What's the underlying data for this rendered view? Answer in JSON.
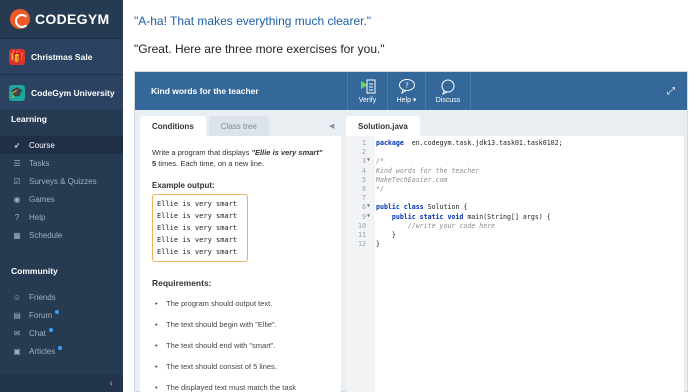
{
  "sidebar": {
    "logo": "CODEGYM",
    "promos": [
      {
        "label": "Christmas Sale",
        "icon": "gift-icon"
      },
      {
        "label": "CodeGym University",
        "icon": "graduation-cap-icon"
      }
    ],
    "learning_title": "Learning",
    "learning_items": [
      {
        "label": "Course",
        "icon": "rocket-icon",
        "active": true
      },
      {
        "label": "Tasks",
        "icon": "list-icon"
      },
      {
        "label": "Surveys & Quizzes",
        "icon": "checklist-icon"
      },
      {
        "label": "Games",
        "icon": "gamepad-icon"
      },
      {
        "label": "Help",
        "icon": "help-circle-icon"
      },
      {
        "label": "Schedule",
        "icon": "calendar-icon"
      }
    ],
    "community_title": "Community",
    "community_items": [
      {
        "label": "Friends",
        "icon": "users-icon"
      },
      {
        "label": "Forum",
        "icon": "forum-icon",
        "dot": true
      },
      {
        "label": "Chat",
        "icon": "chat-icon",
        "dot": true
      },
      {
        "label": "Articles",
        "icon": "articles-icon",
        "dot": true
      }
    ],
    "collapse_icon": "chevron-left-icon"
  },
  "dialog": {
    "line1": "\"A-ha! That makes everything much clearer.\"",
    "line2": "\"Great. Here are three more exercises for you.\""
  },
  "task": {
    "title": "Kind words for the teacher",
    "buttons": [
      {
        "label": "Verify",
        "icon": "verify-icon"
      },
      {
        "label": "Help",
        "icon": "help-bubble-icon"
      },
      {
        "label": "Discuss",
        "icon": "discuss-icon"
      }
    ],
    "tabs": [
      "Conditions",
      "Class tree"
    ],
    "file_tab": "Solution.java",
    "conditions": {
      "intro_before": "Write a program that displays ",
      "intro_highlight": "\"Ellie is very smart\"",
      "intro_count": "5",
      "intro_after": " times. Each time, on a new line.",
      "example_label": "Example output:",
      "example_lines": [
        "Ellie is very smart",
        "Ellie is very smart",
        "Ellie is very smart",
        "Ellie is very smart",
        "Ellie is very smart"
      ],
      "requirements_title": "Requirements:",
      "requirements": [
        "The program should output text.",
        "The text should begin with \"Ellie\".",
        "The text should end with \"smart\".",
        "The text should consist of 5 lines.",
        "The displayed text must match the task"
      ]
    },
    "code_lines": [
      {
        "n": "1",
        "parts": [
          [
            "kw",
            "package"
          ],
          [
            "",
            "  en.codegym.task.jdk13.task01.task0102;"
          ]
        ]
      },
      {
        "n": "2",
        "parts": []
      },
      {
        "n": "3",
        "fold": true,
        "parts": [
          [
            "cm",
            "/*"
          ]
        ]
      },
      {
        "n": "4",
        "parts": [
          [
            "cm",
            "Kind words for the teacher"
          ]
        ]
      },
      {
        "n": "5",
        "parts": [
          [
            "cm",
            "MakeTechEasier.com"
          ]
        ]
      },
      {
        "n": "6",
        "parts": [
          [
            "cm",
            "*/"
          ]
        ]
      },
      {
        "n": "7",
        "parts": []
      },
      {
        "n": "8",
        "fold": true,
        "parts": [
          [
            "kw",
            "public class"
          ],
          [
            "",
            " Solution {"
          ]
        ]
      },
      {
        "n": "9",
        "fold": true,
        "parts": [
          [
            "",
            "    "
          ],
          [
            "kw",
            "public static void"
          ],
          [
            "",
            " main(String[] args) {"
          ]
        ]
      },
      {
        "n": "10",
        "parts": [
          [
            "",
            "        "
          ],
          [
            "cm",
            "//write your code here"
          ]
        ]
      },
      {
        "n": "11",
        "parts": [
          [
            "",
            "    }"
          ]
        ]
      },
      {
        "n": "12",
        "parts": [
          [
            "",
            "}"
          ]
        ]
      }
    ]
  }
}
